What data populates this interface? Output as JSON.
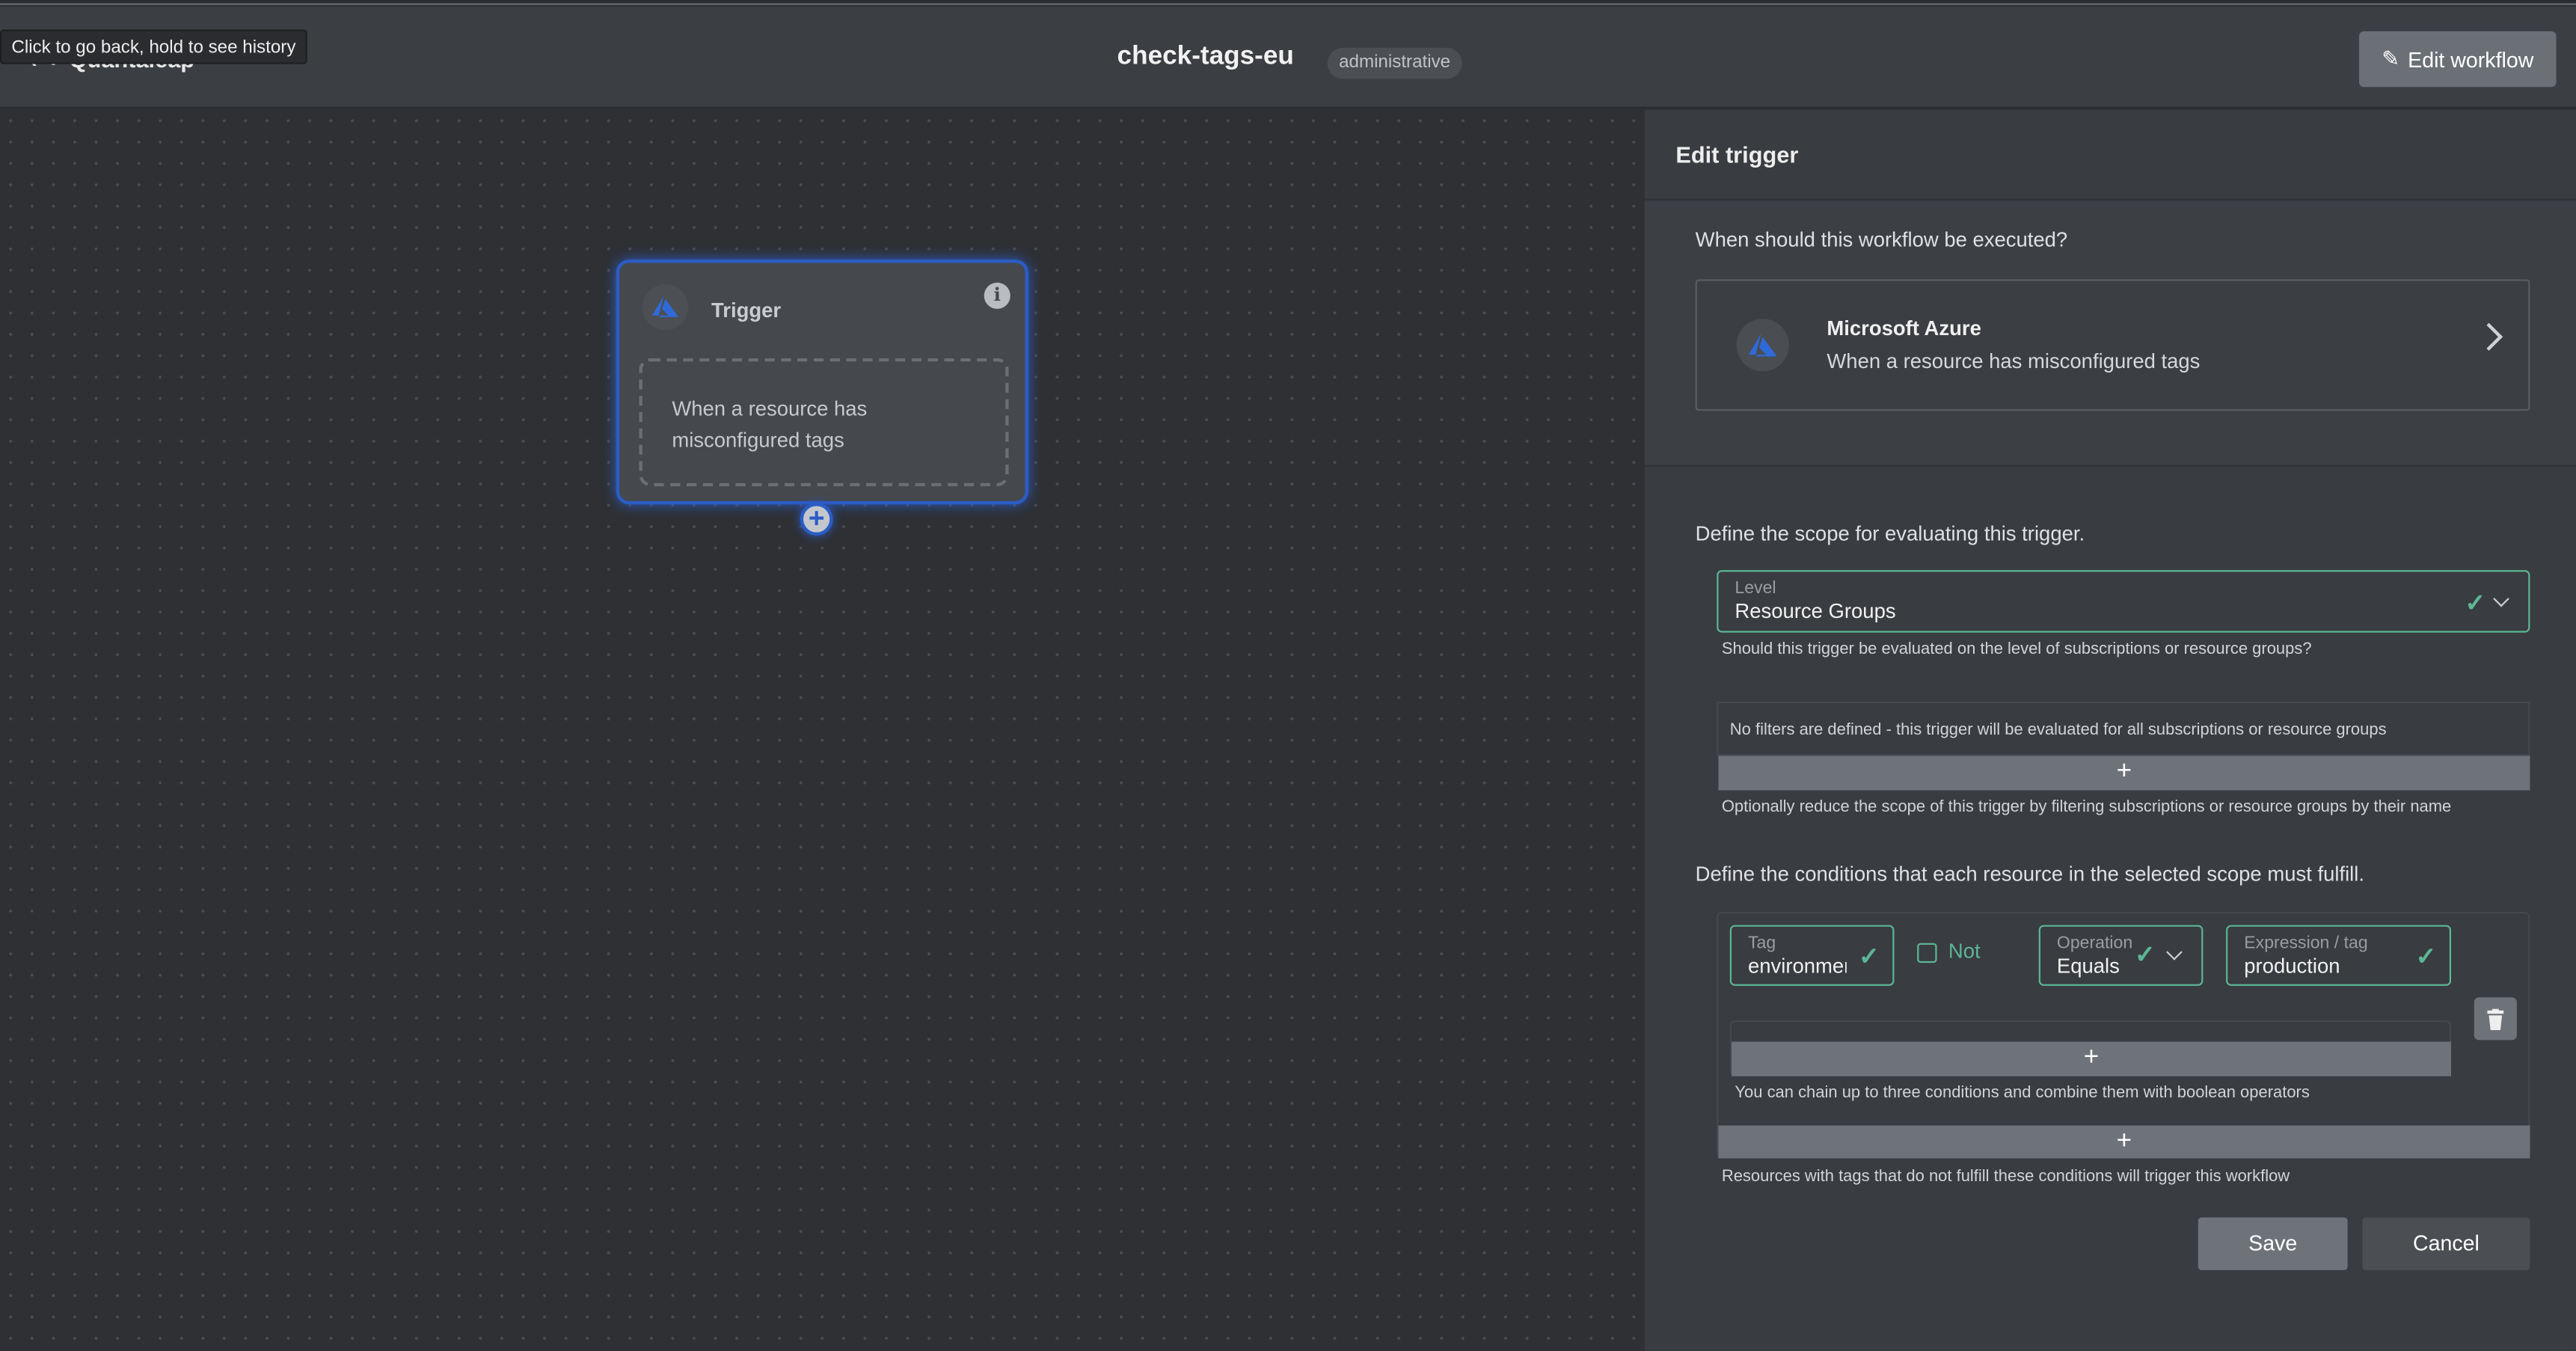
{
  "header": {
    "logo": "Quantaleap",
    "tooltip": "Click to go back, hold to see history",
    "title": "check-tags-eu",
    "badge": "administrative",
    "edit_workflow": "Edit workflow"
  },
  "canvas": {
    "node": {
      "title": "Trigger",
      "description": "When a resource has misconfigured tags",
      "info": "i",
      "add": "+"
    }
  },
  "panel": {
    "title": "Edit trigger",
    "when_label": "When should this workflow be executed?",
    "provider": {
      "name": "Microsoft Azure",
      "description": "When a resource has misconfigured tags"
    },
    "scope_label": "Define the scope for evaluating this trigger.",
    "level": {
      "label": "Level",
      "value": "Resource Groups",
      "help": "Should this trigger be evaluated on the level of subscriptions or resource groups?"
    },
    "filters": {
      "empty": "No filters are defined - this trigger will be evaluated for all subscriptions or resource groups",
      "add": "+",
      "help": "Optionally reduce the scope of this trigger by filtering subscriptions or resource groups by their name"
    },
    "conditions_label": "Define the conditions that each resource in the selected scope must fulfill.",
    "condition": {
      "tag_label": "Tag",
      "tag_value": "environment",
      "not_label": "Not",
      "not_checked": false,
      "op_label": "Operation",
      "op_value": "Equals",
      "expr_label": "Expression / tag",
      "expr_value": "production"
    },
    "chain": {
      "add": "+",
      "help": "You can chain up to three conditions and combine them with boolean operators"
    },
    "groups": {
      "add": "+",
      "help": "Resources with tags that do not fulfill these conditions will trigger this workflow"
    },
    "save": "Save",
    "cancel": "Cancel"
  },
  "colors": {
    "accent": "#5cb695",
    "node_border": "#2c5cc5",
    "azure": "#2f6ad9"
  }
}
